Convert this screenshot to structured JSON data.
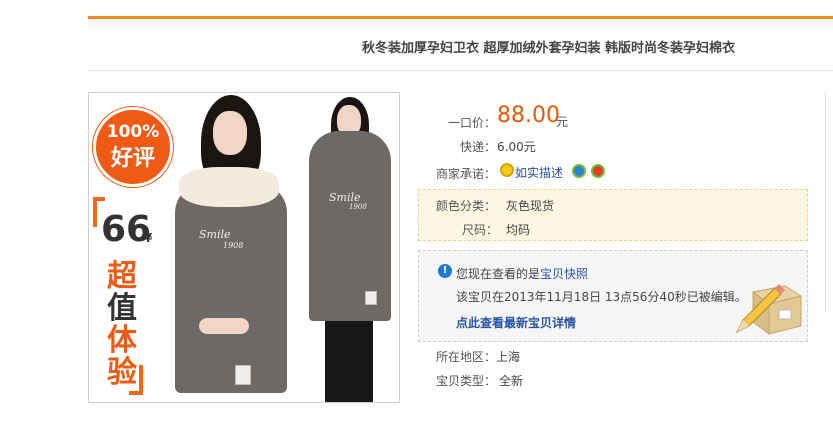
{
  "product": {
    "title": "秋冬装加厚孕妇卫衣 超厚加绒外套孕妇装 韩版时尚冬装孕妇棉衣"
  },
  "image": {
    "badge_percent": "100%",
    "badge_text": "好评",
    "promo_price": "66",
    "promo_currency": "¥",
    "promo_chars": [
      "超",
      "值",
      "体",
      "验"
    ],
    "print_text": "Smile",
    "print_year": "1908"
  },
  "pricing": {
    "price_label": "一口价：",
    "price_value": "88.00",
    "price_unit": "元",
    "shipping_label": "快递：",
    "shipping_value": "6.00元",
    "promise_label": "商家承诺：",
    "promise_link": "如实描述"
  },
  "sku": {
    "color_label": "颜色分类：",
    "color_value": "灰色现货",
    "size_label": "尺码：",
    "size_value": "均码"
  },
  "notice": {
    "viewing_prefix": "您现在查看的是",
    "viewing_link": "宝贝快照",
    "edited_text": "该宝贝在2013年11月18日 13点56分40秒已被编辑。",
    "detail_link": "点此查看最新宝贝详情"
  },
  "meta": {
    "location_label": "所在地区：",
    "location_value": "上海",
    "type_label": "宝贝类型：",
    "type_value": "全新"
  },
  "colors": {
    "accent": "#f08d1f",
    "price": "#e45a0c",
    "link": "#2953a6"
  }
}
